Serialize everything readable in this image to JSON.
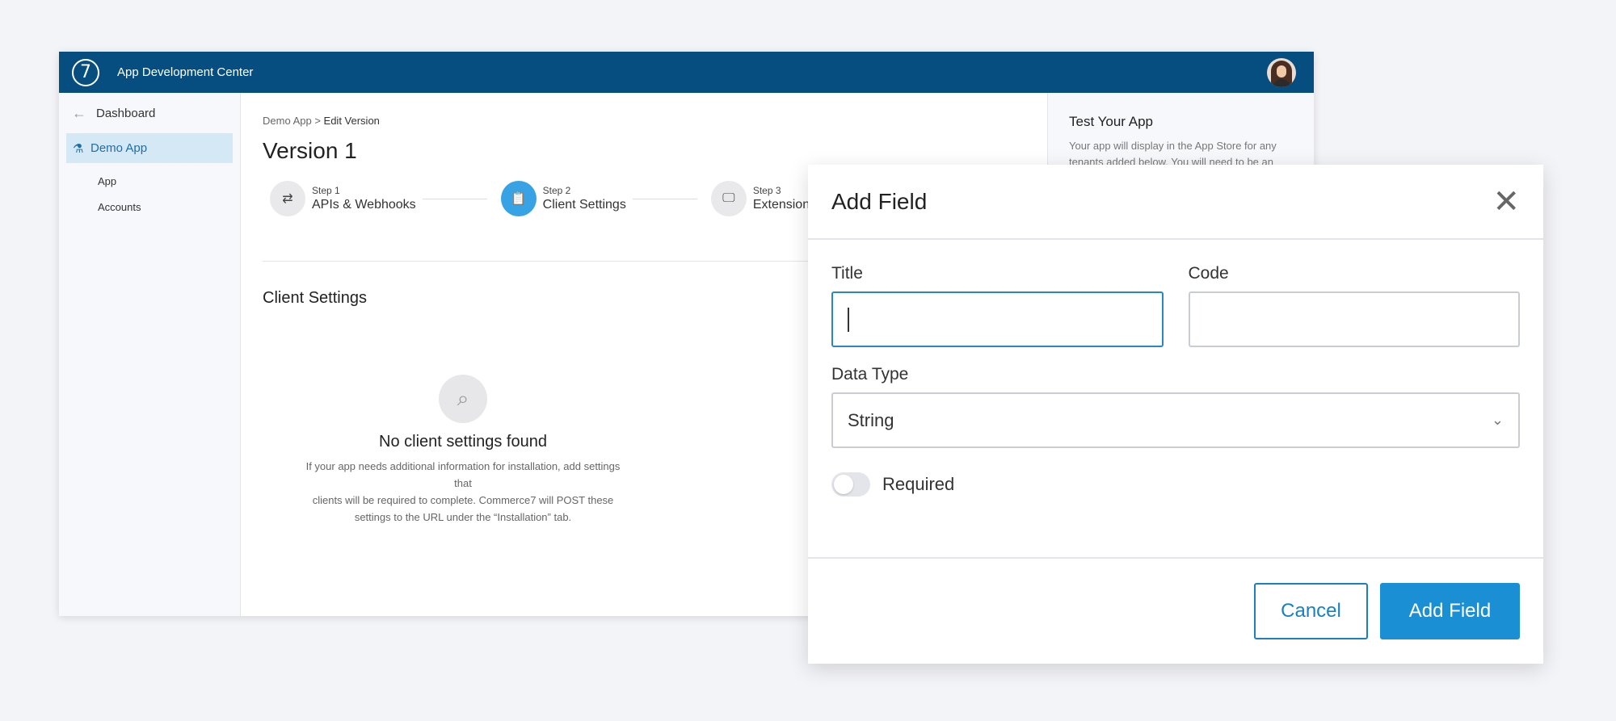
{
  "header": {
    "logo": "7",
    "title": "App Development Center",
    "avatar": "avatar"
  },
  "sidebar": {
    "back_label": "Dashboard",
    "active_item": "Demo App",
    "sub_items": [
      "App",
      "Accounts"
    ]
  },
  "main": {
    "breadcrumb": {
      "parent": "Demo App",
      "separator": " > ",
      "current": "Edit Version"
    },
    "title": "Version 1",
    "steps": [
      {
        "num": "Step 1",
        "label": "APIs & Webhooks",
        "icon": "swap-arrows-icon",
        "active": false
      },
      {
        "num": "Step 2",
        "label": "Client Settings",
        "icon": "clipboard-icon",
        "active": true
      },
      {
        "num": "Step 3",
        "label": "Extensions",
        "icon": "monitor-icon",
        "active": false
      }
    ],
    "section_title": "Client Settings",
    "empty": {
      "title": "No client settings found",
      "desc_line1": "If your app needs additional information for installation, add settings that",
      "desc_line2": "clients will be required to complete. Commerce7 will POST these",
      "desc_line3": "settings to the URL under the “Installation” tab."
    }
  },
  "right_pane": {
    "title": "Test Your App",
    "desc_line1": "Your app will display in the App Store for any",
    "desc_line2": "tenants added below. You will need to be an"
  },
  "modal": {
    "title": "Add Field",
    "title_label": "Title",
    "title_value": "",
    "code_label": "Code",
    "code_value": "",
    "data_type_label": "Data Type",
    "data_type_value": "String",
    "required_label": "Required",
    "required_on": false,
    "cancel_label": "Cancel",
    "submit_label": "Add Field"
  }
}
